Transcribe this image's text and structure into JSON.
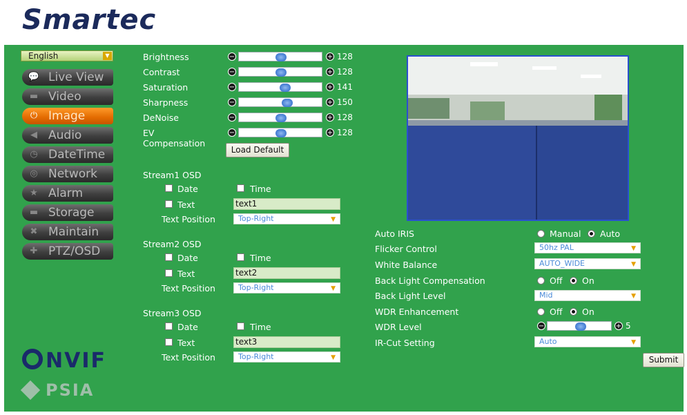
{
  "brand": {
    "logo_text": "Smartec"
  },
  "sidebar": {
    "language": "English",
    "items": [
      {
        "label": "Live View",
        "icon": "chat-bubble-icon",
        "active": false
      },
      {
        "label": "Video",
        "icon": "camera-icon",
        "active": false
      },
      {
        "label": "Image",
        "icon": "power-icon",
        "active": true
      },
      {
        "label": "Audio",
        "icon": "speaker-icon",
        "active": false
      },
      {
        "label": "DateTime",
        "icon": "clock-icon",
        "active": false
      },
      {
        "label": "Network",
        "icon": "globe-icon",
        "active": false
      },
      {
        "label": "Alarm",
        "icon": "alarm-icon",
        "active": false
      },
      {
        "label": "Storage",
        "icon": "drive-icon",
        "active": false
      },
      {
        "label": "Maintain",
        "icon": "tools-icon",
        "active": false
      },
      {
        "label": "PTZ/OSD",
        "icon": "ptz-icon",
        "active": false
      }
    ],
    "onvif": "NVIF",
    "psia": "PSIA"
  },
  "image_settings": {
    "sliders": [
      {
        "label": "Brightness",
        "value": "128",
        "fraction": 0.5
      },
      {
        "label": "Contrast",
        "value": "128",
        "fraction": 0.5
      },
      {
        "label": "Saturation",
        "value": "141",
        "fraction": 0.553
      },
      {
        "label": "Sharpness",
        "value": "150",
        "fraction": 0.588
      },
      {
        "label": "DeNoise",
        "value": "128",
        "fraction": 0.5
      },
      {
        "label": "EV Compensation",
        "value": "128",
        "fraction": 0.5
      }
    ],
    "load_default": "Load Default"
  },
  "osd": {
    "date_label": "Date",
    "time_label": "Time",
    "text_label": "Text",
    "position_label": "Text Position",
    "streams": [
      {
        "title": "Stream1 OSD",
        "text": "text1",
        "position": "Top-Right"
      },
      {
        "title": "Stream2 OSD",
        "text": "text2",
        "position": "Top-Right"
      },
      {
        "title": "Stream3 OSD",
        "text": "text3",
        "position": "Top-Right"
      }
    ]
  },
  "camera": {
    "auto_iris": {
      "label": "Auto IRIS",
      "opt1": "Manual",
      "opt2": "Auto"
    },
    "flicker": {
      "label": "Flicker Control",
      "value": "50hz PAL"
    },
    "white_balance": {
      "label": "White Balance",
      "value": "AUTO_WIDE"
    },
    "blc": {
      "label": "Back Light Compensation",
      "opt1": "Off",
      "opt2": "On"
    },
    "bll": {
      "label": "Back Light Level",
      "value": "Mid"
    },
    "wdr": {
      "label": "WDR Enhancement",
      "opt1": "Off",
      "opt2": "On"
    },
    "wdr_level": {
      "label": "WDR Level",
      "value": "5"
    },
    "ircut": {
      "label": "IR-Cut Setting",
      "value": "Auto"
    },
    "submit": "Submit"
  },
  "colors": {
    "background": "#31a24c",
    "accent": "#e26a00",
    "brand": "#1b2a5b"
  }
}
